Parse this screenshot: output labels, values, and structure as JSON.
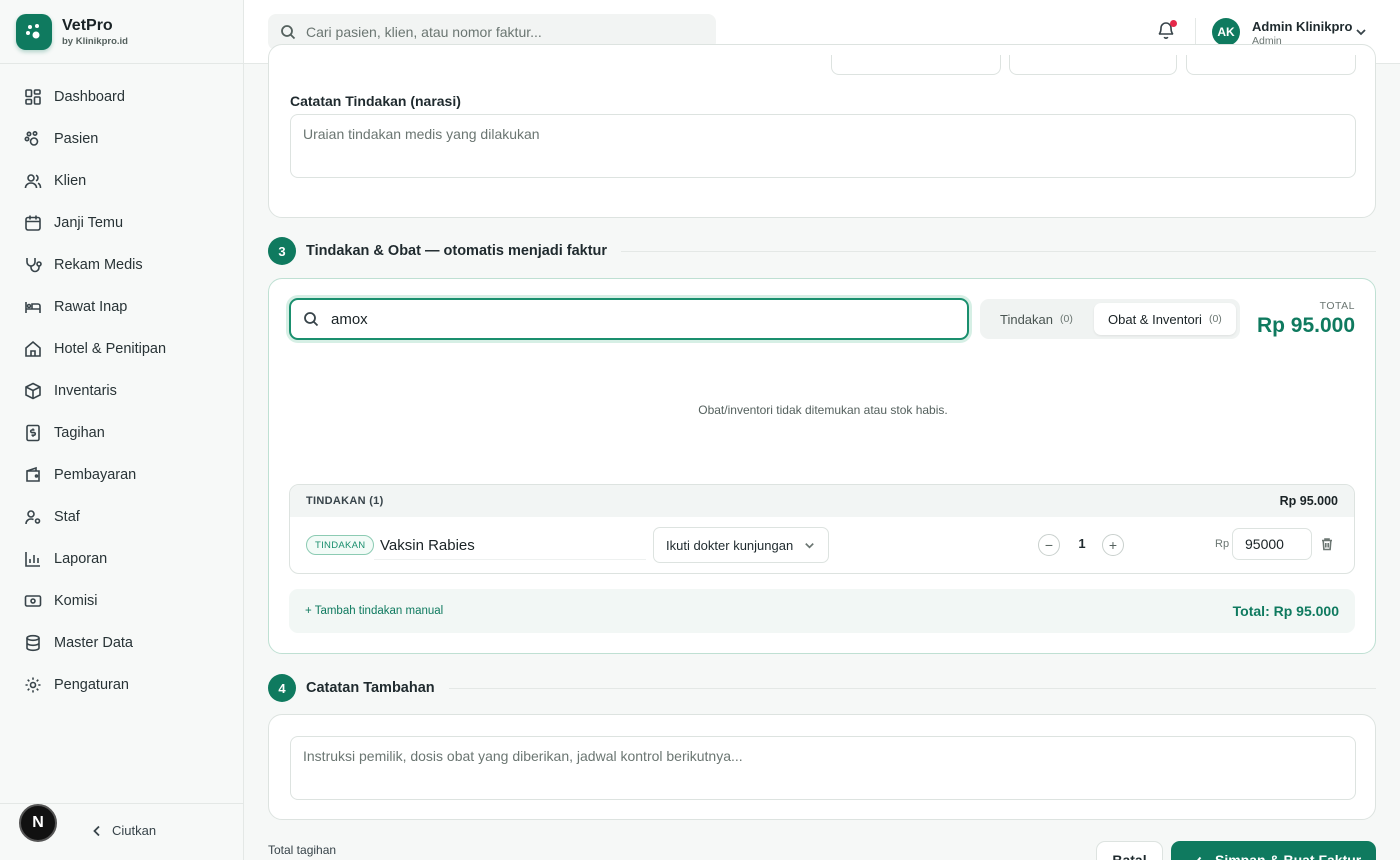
{
  "brand": {
    "name": "VetPro",
    "sub": "by Klinikpro.id"
  },
  "sidebar": {
    "items": [
      {
        "label": "Dashboard",
        "icon": "grid-icon"
      },
      {
        "label": "Pasien",
        "icon": "paw-icon"
      },
      {
        "label": "Klien",
        "icon": "users-icon"
      },
      {
        "label": "Janji Temu",
        "icon": "calendar-icon"
      },
      {
        "label": "Rekam Medis",
        "icon": "stethoscope-icon"
      },
      {
        "label": "Rawat Inap",
        "icon": "bed-icon"
      },
      {
        "label": "Hotel & Penitipan",
        "icon": "home-icon"
      },
      {
        "label": "Inventaris",
        "icon": "box-icon"
      },
      {
        "label": "Tagihan",
        "icon": "invoice-icon"
      },
      {
        "label": "Pembayaran",
        "icon": "wallet-icon"
      },
      {
        "label": "Staf",
        "icon": "user-gear-icon"
      },
      {
        "label": "Laporan",
        "icon": "bar-chart-icon"
      },
      {
        "label": "Komisi",
        "icon": "banknote-icon"
      },
      {
        "label": "Master Data",
        "icon": "database-icon"
      },
      {
        "label": "Pengaturan",
        "icon": "gear-icon"
      }
    ],
    "collapse_label": "Ciutkan",
    "badge_letter": "N"
  },
  "header": {
    "search_placeholder": "Cari pasien, klien, atau nomor faktur...",
    "user_initials": "AK",
    "user_name": "Admin Klinikpro",
    "user_role": "Admin",
    "has_notification": true
  },
  "section2": {
    "notes_label": "Catatan Tindakan (narasi)",
    "notes_placeholder": "Uraian tindakan medis yang dilakukan"
  },
  "section3": {
    "number": "3",
    "title": "Tindakan & Obat — otomatis menjadi faktur",
    "search_value": "amox",
    "tabs": [
      {
        "label": "Tindakan",
        "count": "(0)",
        "active": false
      },
      {
        "label": "Obat & Inventori",
        "count": "(0)",
        "active": true
      }
    ],
    "total_label": "TOTAL",
    "total_value": "Rp 95.000",
    "empty_message": "Obat/inventori tidak ditemukan atau stok habis.",
    "table": {
      "header_label": "TINDAKAN (1)",
      "header_amount": "Rp 95.000",
      "rows": [
        {
          "tag": "TINDAKAN",
          "name": "Vaksin Rabies",
          "doctor_select": "Ikuti dokter kunjungan",
          "qty": "1",
          "currency": "Rp",
          "price": "95000"
        }
      ]
    },
    "add_manual": "+ Tambah tindakan manual",
    "footer_total": "Total: Rp 95.000"
  },
  "section4": {
    "number": "4",
    "title": "Catatan Tambahan",
    "placeholder": "Instruksi pemilik, dosis obat yang diberikan, jadwal kontrol berikutnya..."
  },
  "footer": {
    "total_label": "Total tagihan",
    "cancel_label": "Batal",
    "save_label": "Simpan & Buat Faktur"
  },
  "colors": {
    "accent": "#0f7a5f",
    "notification": "#e5294a"
  }
}
